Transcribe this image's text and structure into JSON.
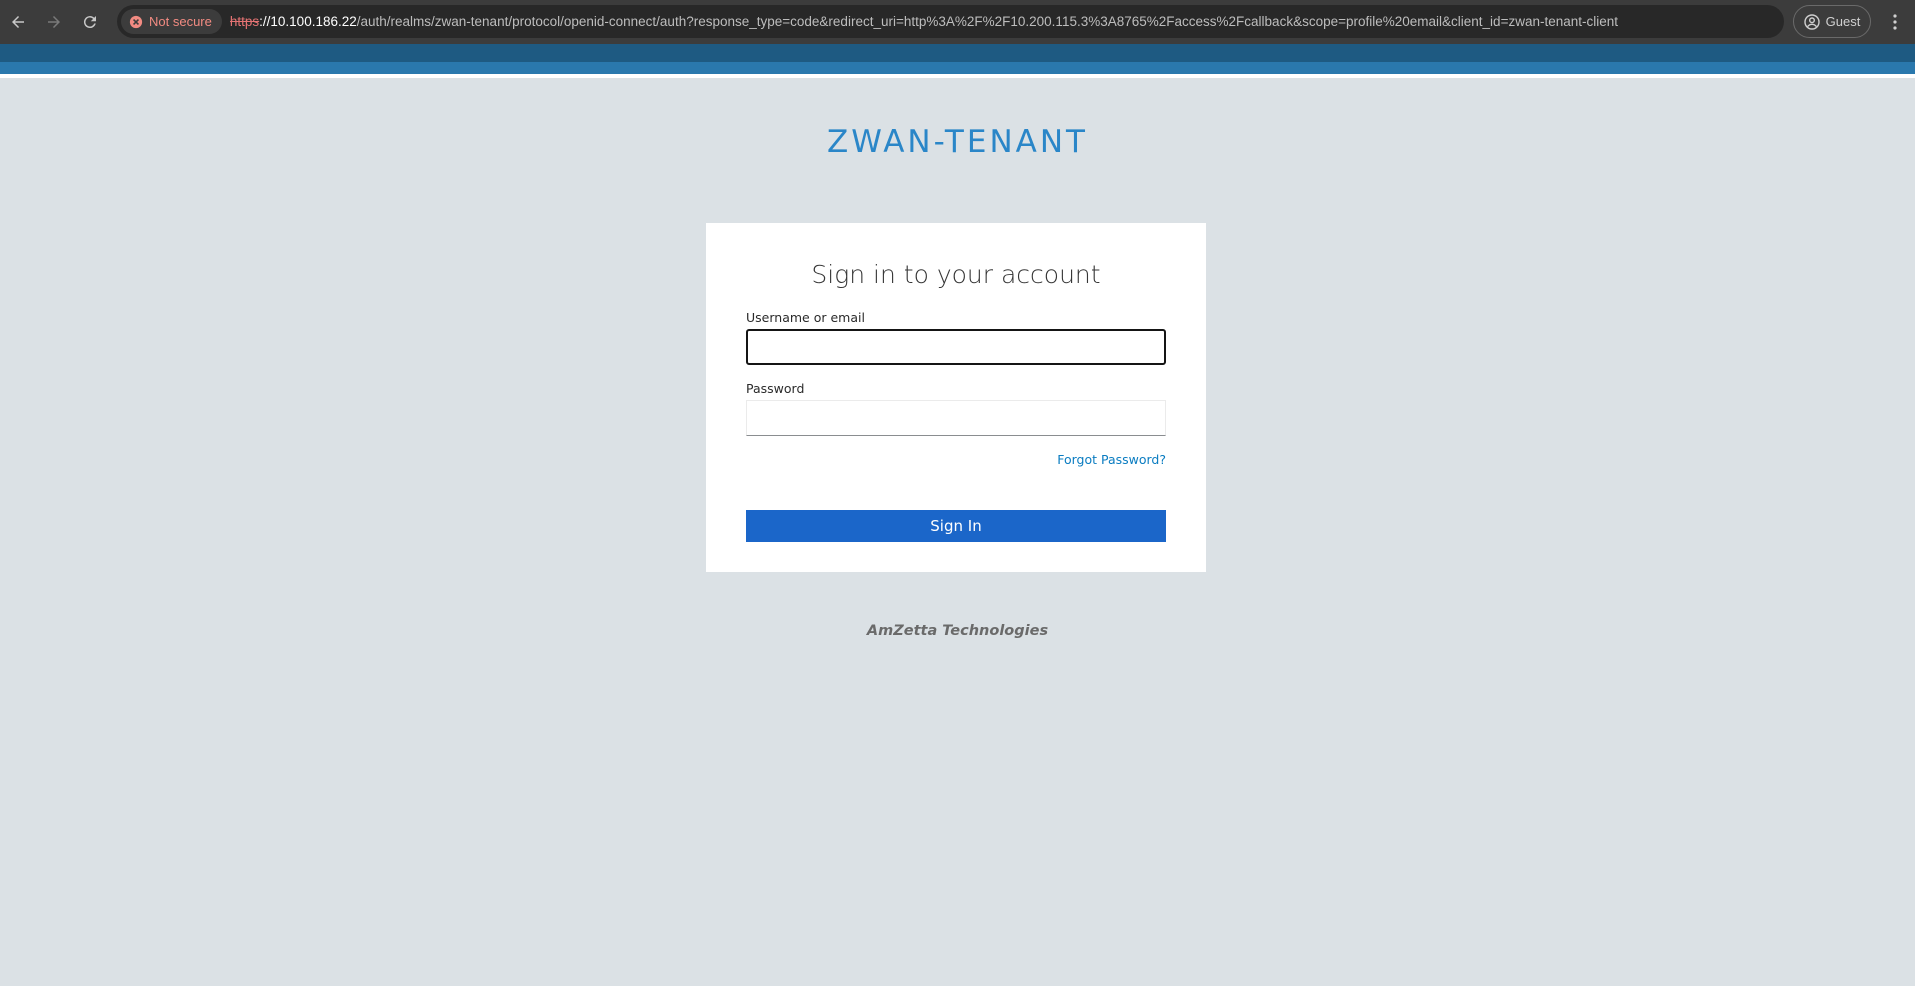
{
  "browser": {
    "security_label": "Not secure",
    "url_scheme": "https",
    "url_host": "://10.100.186.22",
    "url_path": "/auth/realms/zwan-tenant/protocol/openid-connect/auth?response_type=code&redirect_uri=http%3A%2F%2F10.200.115.3%3A8765%2Faccess%2Fcallback&scope=profile%20email&client_id=zwan-tenant-client",
    "profile_label": "Guest",
    "icons": {
      "back": "arrow-left-icon",
      "forward": "arrow-right-icon",
      "reload": "reload-icon",
      "security": "warning-circle-icon",
      "profile": "person-circle-icon",
      "menu": "vertical-dots-icon"
    }
  },
  "realm": {
    "title": "ZWAN-TENANT"
  },
  "login": {
    "heading": "Sign in to your account",
    "username_label": "Username or email",
    "username_value": "",
    "password_label": "Password",
    "password_value": "",
    "forgot_password": "Forgot Password?",
    "submit_label": "Sign In"
  },
  "footer": {
    "brand": "AmZetta Technologies"
  },
  "colors": {
    "page_background": "#dbe1e5",
    "header_dark": "#1e5a82",
    "header_mid": "#2a78ad",
    "title_accent": "#2a86c8",
    "primary_button": "#1b66c9",
    "link": "#0a7cc1",
    "not_secure": "#f28b82"
  }
}
